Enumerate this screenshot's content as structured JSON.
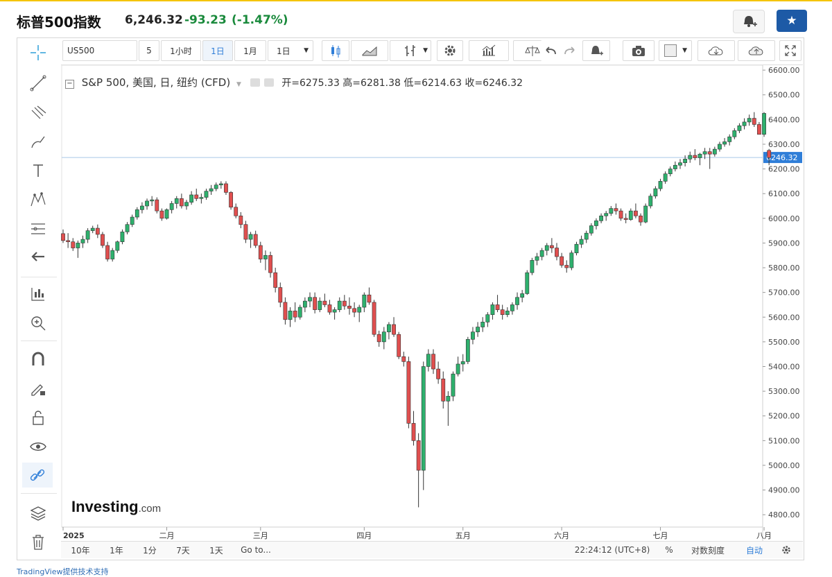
{
  "header": {
    "title": "标普500指数",
    "price": "6,246.32",
    "change": "-93.23",
    "change_pct": "(-1.47%)"
  },
  "toolbar": {
    "symbol": "US500",
    "interval_count": "5",
    "btn_1h": "1小时",
    "btn_1d": "1日",
    "btn_1m": "1月",
    "btn_interval": "1日"
  },
  "legend": {
    "name": "S&P 500, 美国, 日, 纽约 (CFD)",
    "ohlc": "开=6275.33  高=6281.38  低=6214.63  收=6246.32"
  },
  "watermark": {
    "brand": "Investing",
    "suffix": ".com"
  },
  "bottom": {
    "ranges": [
      "10年",
      "1年",
      "1分",
      "7天",
      "1天"
    ],
    "goto": "Go to...",
    "time": "22:24:12 (UTC+8)",
    "pct": "%",
    "log": "对数刻度",
    "auto": "自动"
  },
  "footer": "TradingView提供技术支持",
  "colors": {
    "up": "#2eb06d",
    "down": "#e04f4f",
    "accent": "#2f7ed8",
    "change": "#1a8a3c"
  },
  "chart_data": {
    "type": "candlestick",
    "last_price_label": "6246.32",
    "last_price": 6246.32,
    "ylim": [
      4750,
      6620
    ],
    "yticks": [
      6600,
      6500,
      6400,
      6300,
      6200,
      6100,
      6000,
      5900,
      5800,
      5700,
      5600,
      5500,
      5400,
      5300,
      5200,
      5100,
      5000,
      4900,
      4800
    ],
    "ytick_labels": [
      "6600.00",
      "6500.00",
      "6400.00",
      "6300.00",
      "6200.00",
      "6100.00",
      "6000.00",
      "5900.00",
      "5800.00",
      "5700.00",
      "5600.00",
      "5500.00",
      "5400.00",
      "5300.00",
      "5200.00",
      "5100.00",
      "5000.00",
      "4900.00",
      "4800.00"
    ],
    "xticks": [
      {
        "label": "2025",
        "index": 0
      },
      {
        "label": "二月",
        "index": 21
      },
      {
        "label": "三月",
        "index": 40
      },
      {
        "label": "四月",
        "index": 61
      },
      {
        "label": "五月",
        "index": 81
      },
      {
        "label": "六月",
        "index": 101
      },
      {
        "label": "七月",
        "index": 121
      },
      {
        "label": "八月",
        "index": 142
      }
    ],
    "candles": [
      [
        5938,
        5955,
        5900,
        5910
      ],
      [
        5910,
        5940,
        5880,
        5905
      ],
      [
        5905,
        5920,
        5868,
        5880
      ],
      [
        5880,
        5910,
        5840,
        5900
      ],
      [
        5900,
        5930,
        5880,
        5915
      ],
      [
        5915,
        5960,
        5900,
        5950
      ],
      [
        5950,
        5970,
        5940,
        5960
      ],
      [
        5960,
        5975,
        5920,
        5935
      ],
      [
        5935,
        5945,
        5880,
        5890
      ],
      [
        5890,
        5905,
        5825,
        5835
      ],
      [
        5835,
        5880,
        5825,
        5870
      ],
      [
        5870,
        5910,
        5860,
        5905
      ],
      [
        5905,
        5955,
        5895,
        5945
      ],
      [
        5945,
        5985,
        5935,
        5975
      ],
      [
        5975,
        6015,
        5965,
        6005
      ],
      [
        6005,
        6045,
        5995,
        6035
      ],
      [
        6035,
        6065,
        6020,
        6050
      ],
      [
        6050,
        6080,
        6035,
        6070
      ],
      [
        6070,
        6090,
        6050,
        6075
      ],
      [
        6075,
        6085,
        6020,
        6030
      ],
      [
        6030,
        6040,
        5990,
        6000
      ],
      [
        6000,
        6040,
        5995,
        6035
      ],
      [
        6035,
        6070,
        6020,
        6060
      ],
      [
        6060,
        6090,
        6040,
        6080
      ],
      [
        6080,
        6100,
        6040,
        6050
      ],
      [
        6050,
        6075,
        6035,
        6065
      ],
      [
        6065,
        6110,
        6055,
        6095
      ],
      [
        6095,
        6120,
        6070,
        6080
      ],
      [
        6080,
        6100,
        6060,
        6085
      ],
      [
        6085,
        6120,
        6075,
        6110
      ],
      [
        6110,
        6135,
        6095,
        6120
      ],
      [
        6120,
        6145,
        6110,
        6135
      ],
      [
        6135,
        6150,
        6120,
        6140
      ],
      [
        6140,
        6150,
        6095,
        6105
      ],
      [
        6105,
        6110,
        6035,
        6045
      ],
      [
        6045,
        6060,
        6000,
        6010
      ],
      [
        6010,
        6025,
        5960,
        5975
      ],
      [
        5975,
        5990,
        5900,
        5915
      ],
      [
        5915,
        5945,
        5880,
        5935
      ],
      [
        5935,
        5950,
        5880,
        5890
      ],
      [
        5890,
        5905,
        5820,
        5835
      ],
      [
        5835,
        5870,
        5790,
        5850
      ],
      [
        5850,
        5865,
        5760,
        5780
      ],
      [
        5780,
        5800,
        5700,
        5720
      ],
      [
        5720,
        5740,
        5640,
        5660
      ],
      [
        5660,
        5680,
        5570,
        5590
      ],
      [
        5590,
        5640,
        5560,
        5625
      ],
      [
        5625,
        5660,
        5580,
        5600
      ],
      [
        5600,
        5650,
        5590,
        5640
      ],
      [
        5640,
        5680,
        5620,
        5665
      ],
      [
        5665,
        5700,
        5640,
        5680
      ],
      [
        5680,
        5700,
        5615,
        5630
      ],
      [
        5630,
        5680,
        5620,
        5665
      ],
      [
        5665,
        5695,
        5640,
        5650
      ],
      [
        5650,
        5670,
        5610,
        5620
      ],
      [
        5620,
        5640,
        5590,
        5630
      ],
      [
        5630,
        5680,
        5620,
        5665
      ],
      [
        5665,
        5690,
        5630,
        5645
      ],
      [
        5645,
        5680,
        5610,
        5635
      ],
      [
        5635,
        5660,
        5600,
        5620
      ],
      [
        5620,
        5650,
        5580,
        5640
      ],
      [
        5640,
        5700,
        5620,
        5690
      ],
      [
        5690,
        5720,
        5650,
        5660
      ],
      [
        5660,
        5670,
        5520,
        5530
      ],
      [
        5530,
        5545,
        5480,
        5500
      ],
      [
        5500,
        5560,
        5470,
        5540
      ],
      [
        5540,
        5580,
        5510,
        5570
      ],
      [
        5570,
        5600,
        5520,
        5530
      ],
      [
        5530,
        5540,
        5430,
        5440
      ],
      [
        5440,
        5460,
        5400,
        5420
      ],
      [
        5420,
        5440,
        5150,
        5170
      ],
      [
        5170,
        5220,
        5080,
        5100
      ],
      [
        5100,
        5130,
        4830,
        4980
      ],
      [
        4980,
        5420,
        4900,
        5400
      ],
      [
        5400,
        5470,
        5380,
        5450
      ],
      [
        5450,
        5470,
        5370,
        5390
      ],
      [
        5390,
        5420,
        5330,
        5350
      ],
      [
        5350,
        5380,
        5230,
        5260
      ],
      [
        5260,
        5300,
        5160,
        5280
      ],
      [
        5280,
        5380,
        5260,
        5370
      ],
      [
        5370,
        5440,
        5360,
        5410
      ],
      [
        5410,
        5450,
        5380,
        5420
      ],
      [
        5420,
        5520,
        5410,
        5510
      ],
      [
        5510,
        5560,
        5490,
        5540
      ],
      [
        5540,
        5580,
        5520,
        5560
      ],
      [
        5560,
        5600,
        5540,
        5580
      ],
      [
        5580,
        5620,
        5560,
        5610
      ],
      [
        5610,
        5660,
        5590,
        5650
      ],
      [
        5650,
        5690,
        5620,
        5630
      ],
      [
        5630,
        5650,
        5590,
        5610
      ],
      [
        5610,
        5640,
        5600,
        5625
      ],
      [
        5625,
        5660,
        5610,
        5650
      ],
      [
        5650,
        5700,
        5630,
        5680
      ],
      [
        5680,
        5710,
        5660,
        5695
      ],
      [
        5695,
        5790,
        5690,
        5780
      ],
      [
        5780,
        5840,
        5770,
        5830
      ],
      [
        5830,
        5860,
        5810,
        5845
      ],
      [
        5845,
        5880,
        5830,
        5870
      ],
      [
        5870,
        5900,
        5850,
        5890
      ],
      [
        5890,
        5920,
        5860,
        5880
      ],
      [
        5880,
        5900,
        5830,
        5845
      ],
      [
        5845,
        5860,
        5800,
        5810
      ],
      [
        5810,
        5830,
        5780,
        5800
      ],
      [
        5800,
        5870,
        5790,
        5860
      ],
      [
        5860,
        5905,
        5850,
        5895
      ],
      [
        5895,
        5930,
        5880,
        5915
      ],
      [
        5915,
        5950,
        5900,
        5940
      ],
      [
        5940,
        5980,
        5930,
        5970
      ],
      [
        5970,
        6000,
        5955,
        5990
      ],
      [
        5990,
        6020,
        5980,
        6010
      ],
      [
        6010,
        6030,
        5990,
        6020
      ],
      [
        6020,
        6050,
        6010,
        6040
      ],
      [
        6040,
        6060,
        6015,
        6030
      ],
      [
        6030,
        6040,
        5990,
        6000
      ],
      [
        6000,
        6020,
        5980,
        5995
      ],
      [
        5995,
        6040,
        5990,
        6030
      ],
      [
        6030,
        6060,
        6000,
        6010
      ],
      [
        6010,
        6020,
        5970,
        5985
      ],
      [
        5985,
        6060,
        5980,
        6050
      ],
      [
        6050,
        6100,
        6040,
        6090
      ],
      [
        6090,
        6130,
        6080,
        6120
      ],
      [
        6120,
        6160,
        6110,
        6150
      ],
      [
        6150,
        6190,
        6140,
        6180
      ],
      [
        6180,
        6210,
        6170,
        6200
      ],
      [
        6200,
        6230,
        6190,
        6215
      ],
      [
        6215,
        6240,
        6200,
        6225
      ],
      [
        6225,
        6255,
        6210,
        6240
      ],
      [
        6240,
        6270,
        6225,
        6255
      ],
      [
        6255,
        6280,
        6235,
        6245
      ],
      [
        6245,
        6265,
        6215,
        6260
      ],
      [
        6260,
        6285,
        6240,
        6270
      ],
      [
        6270,
        6285,
        6200,
        6260
      ],
      [
        6260,
        6290,
        6250,
        6280
      ],
      [
        6280,
        6310,
        6270,
        6300
      ],
      [
        6300,
        6325,
        6290,
        6310
      ],
      [
        6310,
        6340,
        6295,
        6330
      ],
      [
        6330,
        6365,
        6320,
        6355
      ],
      [
        6355,
        6385,
        6345,
        6375
      ],
      [
        6375,
        6405,
        6360,
        6390
      ],
      [
        6390,
        6420,
        6375,
        6405
      ],
      [
        6405,
        6430,
        6370,
        6380
      ],
      [
        6380,
        6390,
        6340,
        6340
      ],
      [
        6340,
        6430,
        6330,
        6425
      ],
      [
        6275,
        6281,
        6215,
        6246
      ]
    ]
  }
}
